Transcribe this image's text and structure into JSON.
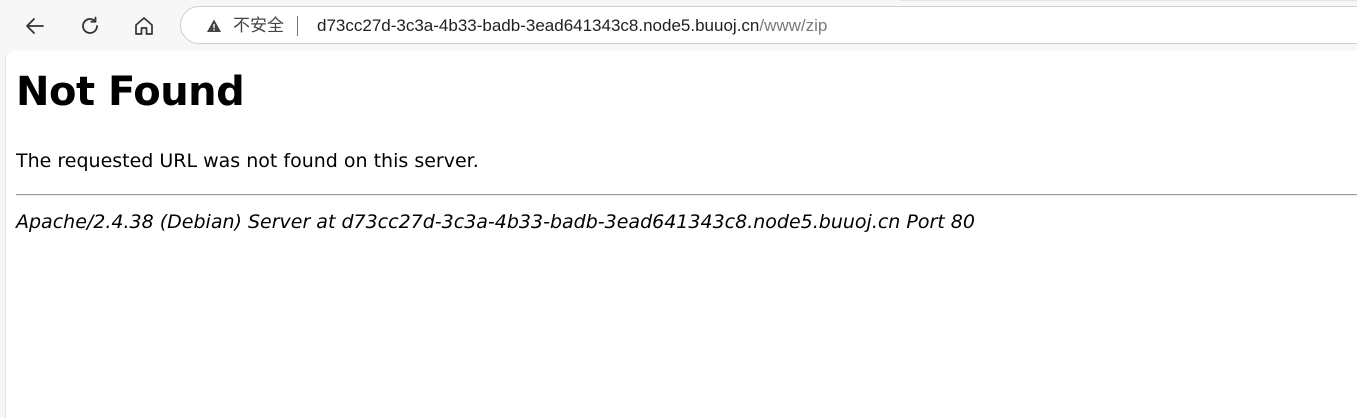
{
  "browser": {
    "security_label": "不安全",
    "url_host": "d73cc27d-3c3a-4b33-badb-3ead641343c8.node5.buuoj.cn",
    "url_path": "/www/zip",
    "icons": [
      "back-arrow-icon",
      "reload-icon",
      "home-icon",
      "warning-icon"
    ]
  },
  "page": {
    "title": "Not Found",
    "message": "The requested URL was not found on this server.",
    "server_signature": "Apache/2.4.38 (Debian) Server at d73cc27d-3c3a-4b33-badb-3ead641343c8.node5.buuoj.cn Port 80"
  }
}
